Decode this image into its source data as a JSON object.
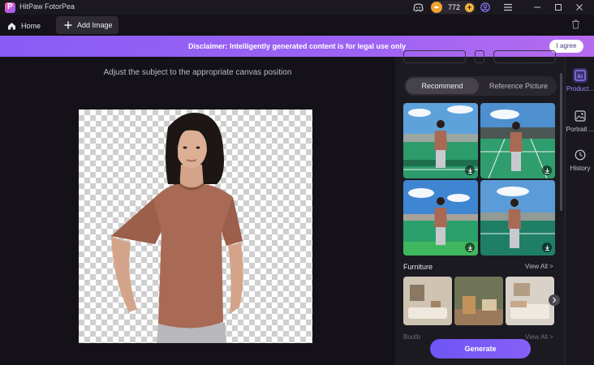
{
  "titlebar": {
    "app_title": "HitPaw FotorPea",
    "logo_letter": "P",
    "coin_count": "772",
    "coin_add": "+"
  },
  "tabs": {
    "home_label": "Home",
    "add_image_label": "Add Image"
  },
  "disclaimer": {
    "text": "Disclaimer: Intelligently generated content is for legal use only",
    "agree_label": "I agree"
  },
  "canvas": {
    "hint": "Adjust the subject to the appropriate canvas position"
  },
  "panel": {
    "tab_recommend": "Recommend",
    "tab_reference": "Reference Picture",
    "section_furniture": "Furniture",
    "view_all_furniture": "View All >",
    "section_booth": "Booth",
    "view_all_booth": "View All >",
    "generate_label": "Generate"
  },
  "rail": {
    "items": [
      {
        "label": "Product...",
        "icon": "ai-icon"
      },
      {
        "label": "Portrait ...",
        "icon": "portrait-icon"
      },
      {
        "label": "History",
        "icon": "history-icon"
      }
    ]
  },
  "colors": {
    "accent": "#8a5cf5",
    "generate": "#7b5af6",
    "coin": "#f0a22e",
    "shirt": "#a86a55"
  }
}
